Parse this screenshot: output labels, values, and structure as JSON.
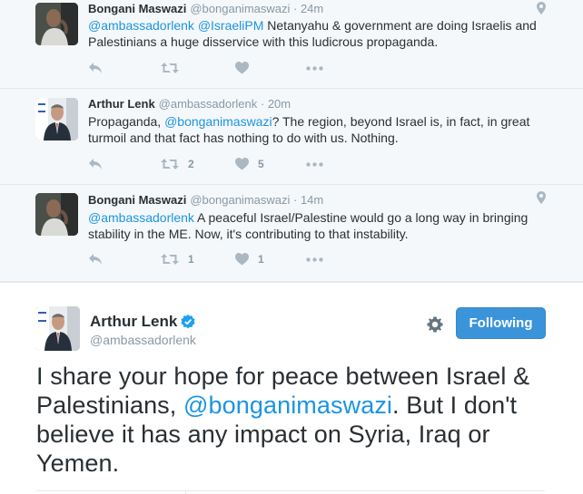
{
  "replies": [
    {
      "name": "Bongani Maswazi",
      "handle": "@bonganimaswazi",
      "time": "· 24m",
      "text_parts": [
        {
          "text": "@ambassadorlenk",
          "link": true
        },
        {
          "text": " ",
          "link": false
        },
        {
          "text": "@IsraeliPM",
          "link": true
        },
        {
          "text": " Netanyahu & government are doing Israelis and Palestinians a huge disservice with this ludicrous propaganda.",
          "link": false
        }
      ],
      "retweets": "",
      "likes": ""
    },
    {
      "name": "Arthur Lenk",
      "handle": "@ambassadorlenk",
      "time": "· 20m",
      "text_parts": [
        {
          "text": "Propaganda, ",
          "link": false
        },
        {
          "text": "@bonganimaswazi",
          "link": true
        },
        {
          "text": "? The region, beyond Israel is, in fact, in great turmoil and that fact has nothing to do with us. Nothing.",
          "link": false
        }
      ],
      "retweets": "2",
      "likes": "5"
    },
    {
      "name": "Bongani Maswazi",
      "handle": "@bonganimaswazi",
      "time": "· 14m",
      "text_parts": [
        {
          "text": "@ambassadorlenk",
          "link": true
        },
        {
          "text": " A peaceful Israel/Palestine would go a long way in bringing stability in the ME. Now, it's contributing to that instability.",
          "link": false
        }
      ],
      "retweets": "1",
      "likes": "1"
    }
  ],
  "main_tweet": {
    "name": "Arthur Lenk",
    "handle": "@ambassadorlenk",
    "follow_label": "Following",
    "text_parts": [
      {
        "text": "I share your hope for peace between Israel & Palestinians, ",
        "link": false
      },
      {
        "text": "@bonganimaswazi",
        "link": true
      },
      {
        "text": ". But I don't believe it has any impact on Syria, Iraq or Yemen.",
        "link": false
      }
    ]
  },
  "colors": {
    "link": "#1b95e0",
    "muted": "#8899a6",
    "follow_bg": "#3b94d9",
    "verified": "#1da1f2"
  },
  "icons": [
    "reply-icon",
    "retweet-icon",
    "like-icon",
    "more-icon",
    "location-icon",
    "gear-icon",
    "verified-icon"
  ]
}
